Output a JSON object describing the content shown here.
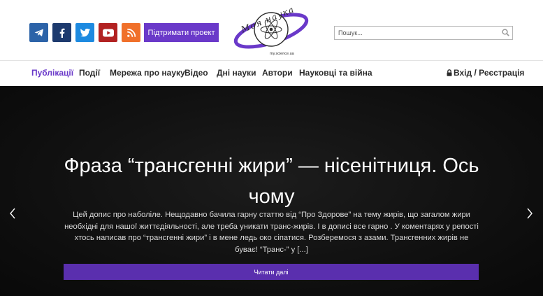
{
  "header": {
    "social": [
      {
        "name": "telegram",
        "icon": "telegram-icon",
        "color": "#2c63a8"
      },
      {
        "name": "facebook",
        "icon": "facebook-icon",
        "color": "#1d3a6e"
      },
      {
        "name": "twitter",
        "icon": "twitter-icon",
        "color": "#1d8ae0"
      },
      {
        "name": "youtube",
        "icon": "youtube-icon",
        "color": "#b22222"
      },
      {
        "name": "rss",
        "icon": "rss-icon",
        "color": "#f0702a"
      }
    ],
    "support_label": "Підтримати проект",
    "logo": {
      "text": "Моя наука",
      "subtext": "my.science.ua"
    },
    "search": {
      "placeholder": "Пошук..."
    }
  },
  "nav": {
    "items": [
      {
        "label": "Публікації",
        "active": true
      },
      {
        "label": "Події"
      },
      {
        "label": "Мережа про науку"
      },
      {
        "label": "Відео"
      },
      {
        "label": "Дні науки"
      },
      {
        "label": "Автори"
      },
      {
        "label": "Науковці та війна"
      }
    ],
    "login_label": "Вхід / Реєстрація"
  },
  "hero": {
    "title": "Фраза “трансгенні жири” — нісенітниця. Ось чому",
    "excerpt": "Цей допис про наболіле. Нещодавно бачила гарну статтю від “Про Здорове” на тему жирів, що загалом жири необхідні для нашої життєдіяльності, але треба уникати транс-жирів. І в дописі все гарно . У коментарях у репості хтось написав про “трансгенні жири” і в мене ледь око сіпатися. Розберемося з азами. Трансгенних жирів не буває! “Транс-” у [...]",
    "read_more": "Читати далі"
  },
  "colors": {
    "accent": "#6a39c9",
    "button": "#5a2fae"
  }
}
